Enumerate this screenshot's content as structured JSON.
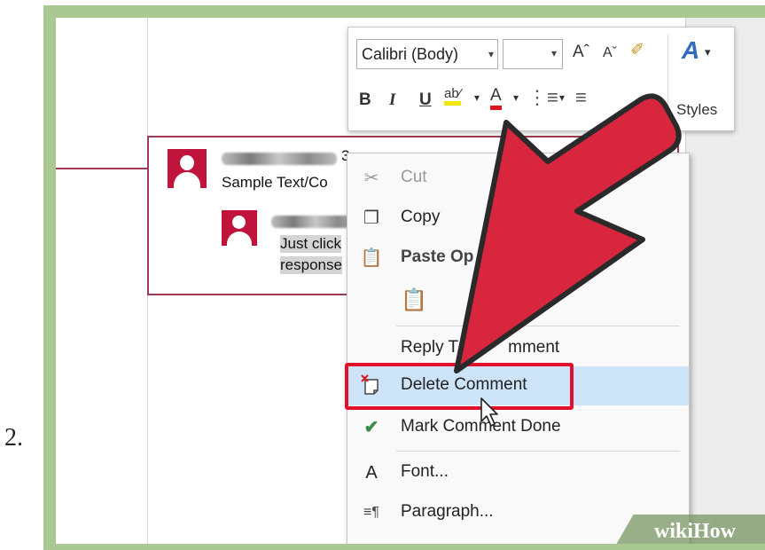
{
  "step_number": "2.",
  "toolbar": {
    "font_name": "Calibri (Body)",
    "styles_label": "Styles"
  },
  "comment": {
    "parent_time_fragment": "3",
    "parent_text": "Sample Text/Co",
    "reply_text_line1": "Just click",
    "reply_text_line2": "response"
  },
  "context_menu": {
    "items": [
      {
        "label": "Cut",
        "icon": "scissors-icon",
        "state": "disabled"
      },
      {
        "label": "Copy",
        "icon": "copy-icon",
        "state": "normal"
      },
      {
        "label": "Paste Options:",
        "icon": "paste-icon",
        "state": "header"
      },
      {
        "label": "",
        "icon": "paste-clipboard-icon",
        "state": "disabled"
      },
      {
        "label": "Reply To Comment",
        "icon": "",
        "state": "normal"
      },
      {
        "label": "Delete Comment",
        "icon": "delete-comment-icon",
        "state": "highlighted"
      },
      {
        "label": "Mark Comment Done",
        "icon": "checkmark-icon",
        "state": "normal"
      },
      {
        "label": "Font...",
        "icon": "font-icon",
        "state": "normal"
      },
      {
        "label": "Paragraph...",
        "icon": "paragraph-icon",
        "state": "normal"
      }
    ]
  },
  "visible_text": {
    "paste_options_cropped": "Paste Op",
    "reply_to_comment_visible": "Reply T",
    "reply_to_comment_tail": "mment"
  },
  "colors": {
    "frame_green": "#a9c892",
    "comment_border": "#9e3b52",
    "avatar_red": "#c0143c",
    "highlight_box_red": "#e3102c",
    "arrow_red": "#d7263d",
    "menu_hover": "#cce3f8"
  },
  "watermark": "wikiHow"
}
